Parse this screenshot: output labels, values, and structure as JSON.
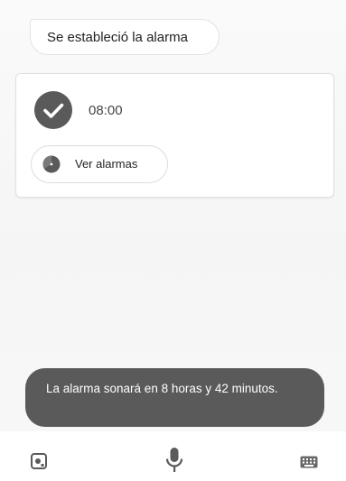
{
  "conversation": {
    "confirmation_message": "Se estableció la alarma"
  },
  "alarm_card": {
    "time": "08:00",
    "status_icon": "check-circle-icon",
    "view_alarms_label": "Ver alarmas",
    "view_alarms_icon": "clock-icon"
  },
  "toast": {
    "message": "La alarma sonará en   8 horas y 42 minutos."
  },
  "bottom_bar": {
    "left_icon": "lens-icon",
    "center_icon": "microphone-icon",
    "right_icon": "keyboard-icon"
  },
  "colors": {
    "toast_background": "#5a5a5a",
    "icon_gray": "#5a5a5a"
  }
}
